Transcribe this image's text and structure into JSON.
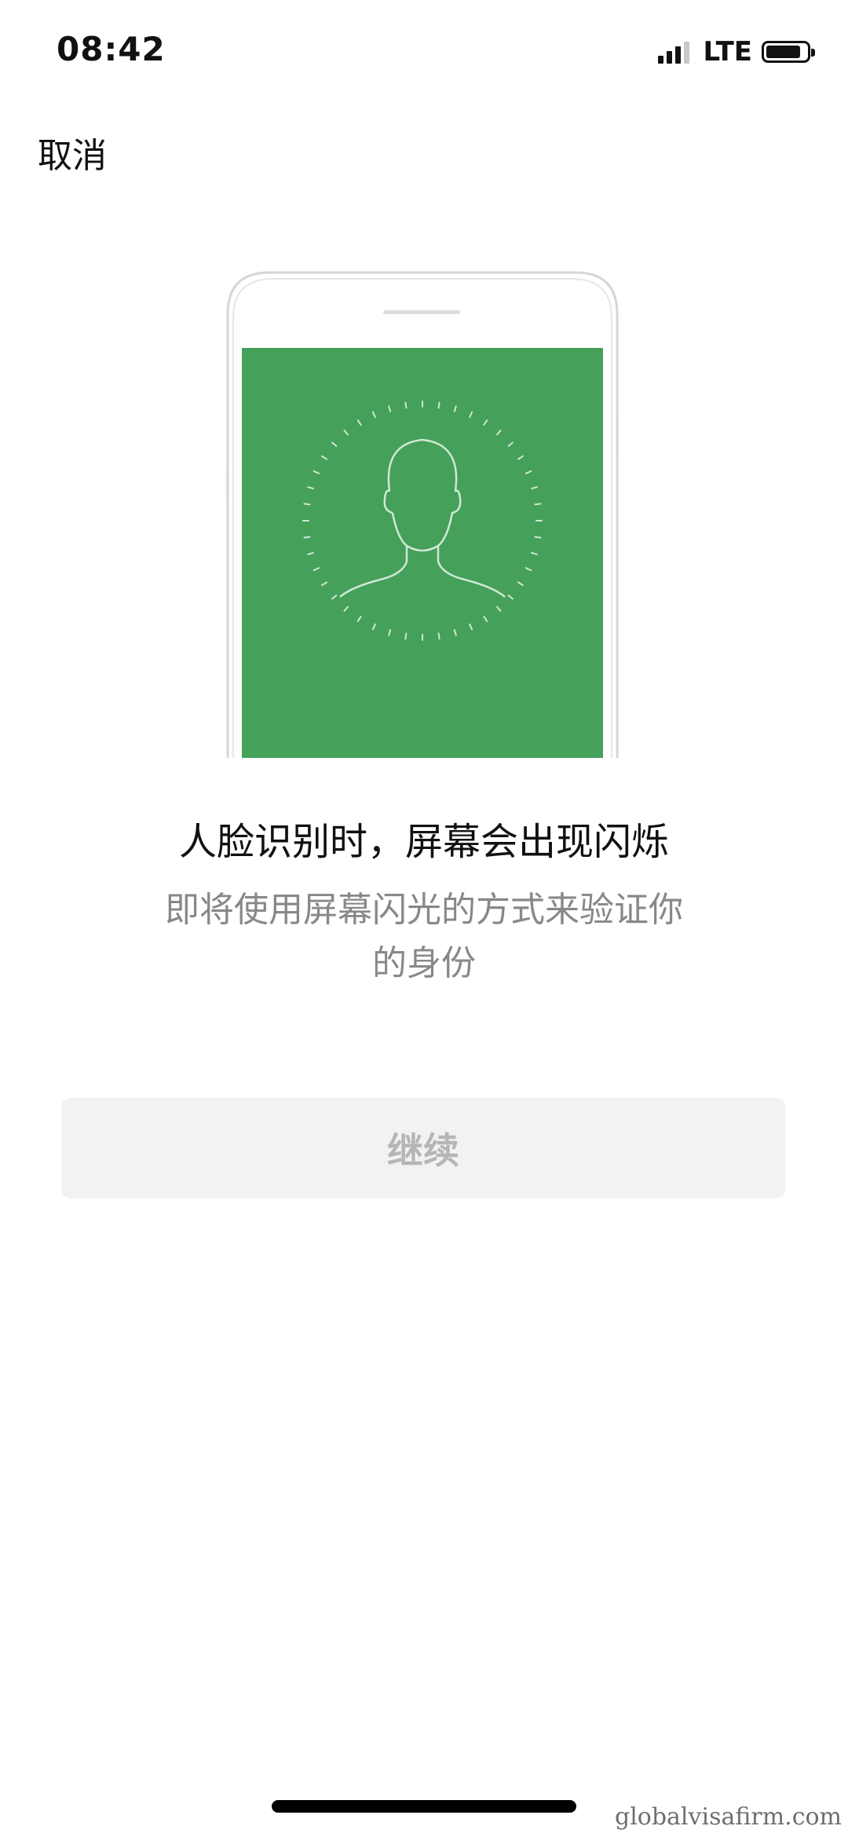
{
  "status_bar": {
    "time": "08:42",
    "network": "LTE",
    "signal_bars": 3,
    "battery_level": 0.85
  },
  "nav": {
    "cancel_label": "取消"
  },
  "illustration": {
    "icon": "face-scan-icon",
    "screen_color": "#45a05a"
  },
  "content": {
    "title": "人脸识别时，屏幕会出现闪烁",
    "subtitle_line1": "即将使用屏幕闪光的方式来验证你",
    "subtitle_line2": "的身份"
  },
  "actions": {
    "continue_label": "继续",
    "continue_enabled": false
  },
  "watermark": "globalvisafirm.com"
}
